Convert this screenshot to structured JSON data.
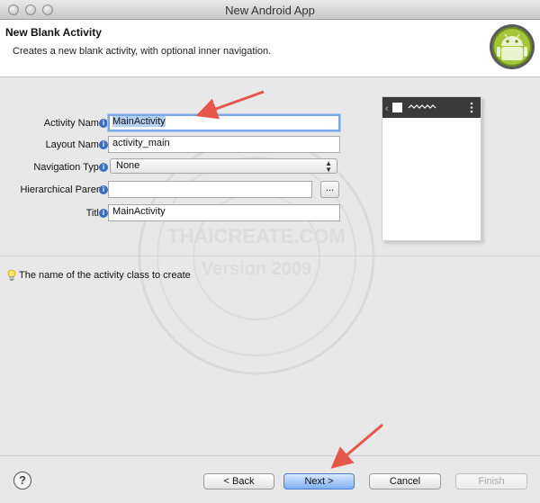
{
  "window": {
    "title": "New Android App"
  },
  "header": {
    "title": "New Blank Activity",
    "description": "Creates a new blank activity, with optional inner navigation."
  },
  "form": {
    "activity_name": {
      "label": "Activity Name",
      "value": "MainActivity"
    },
    "layout_name": {
      "label": "Layout Name",
      "value": "activity_main"
    },
    "navigation_type": {
      "label": "Navigation Type",
      "value": "None"
    },
    "hierarchical_parent": {
      "label": "Hierarchical Parent",
      "value": "",
      "browse_label": "..."
    },
    "title": {
      "label": "Title",
      "value": "MainActivity"
    }
  },
  "hint": {
    "text": "The name of the activity class to create",
    "icon": "lightbulb-icon"
  },
  "watermark": {
    "line1": "THAICREATE.COM",
    "line2": "Version 2009"
  },
  "footer": {
    "help_label": "?",
    "back_label": "< Back",
    "next_label": "Next >",
    "cancel_label": "Cancel",
    "finish_label": "Finish"
  },
  "colors": {
    "android_green": "#a4c639",
    "accent_blue": "#7aa7e6",
    "arrow_red": "#e4574a"
  }
}
